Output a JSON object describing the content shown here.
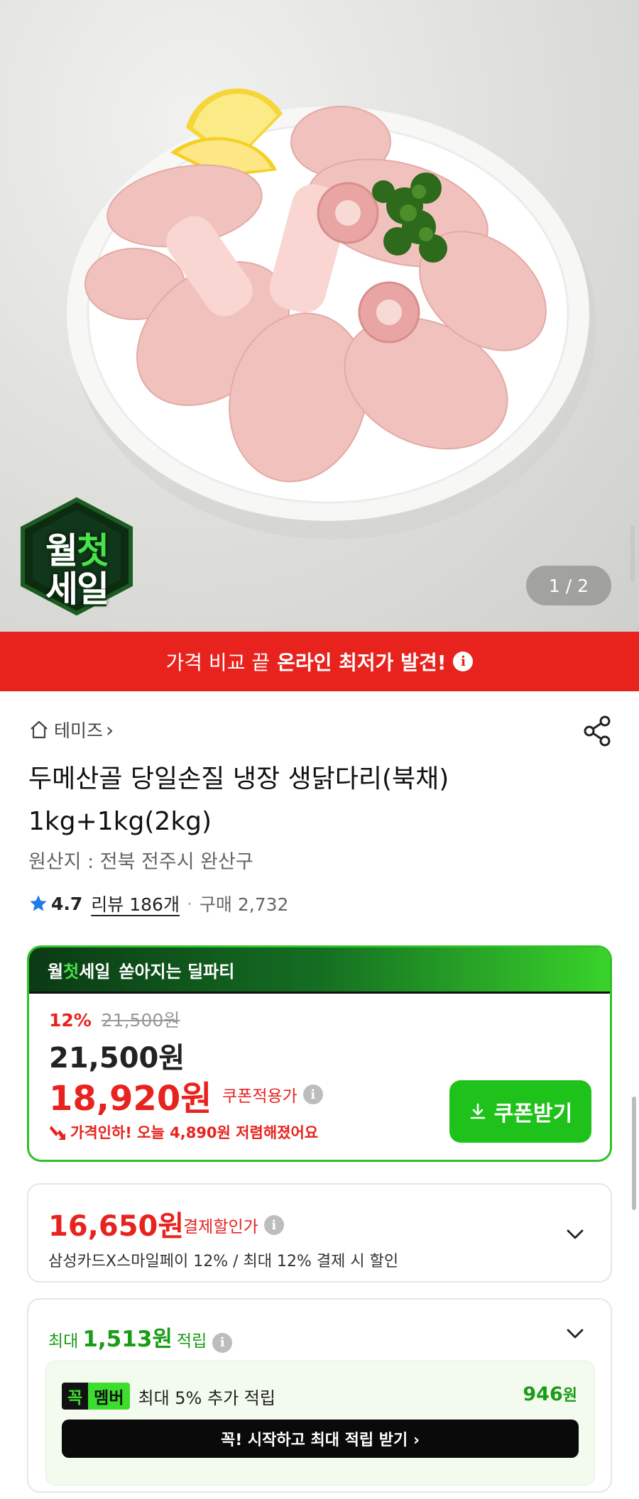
{
  "hero": {
    "badge_line1_a": "월",
    "badge_line1_b": "첫",
    "badge_line2": "세일",
    "counter": "1 / 2"
  },
  "banner": {
    "text": "가격 비교 끝",
    "strong": "온라인 최저가 발견!",
    "info": "i"
  },
  "shop": {
    "name": "테미즈",
    "chevron": "›"
  },
  "product": {
    "title": "두메산골 당일손질 냉장 생닭다리(북채) 1kg+1kg(2kg)",
    "origin": "원산지 : 전북 전주시 완산구",
    "rating": "4.7",
    "review_label": "리뷰 186개",
    "dot": "·",
    "purchase": "구매 2,732"
  },
  "deal": {
    "head_a": "월",
    "head_b": "첫",
    "head_c": "세일",
    "head_sub": "쏟아지는 딜파티",
    "discount_pct": "12%",
    "original_price": "21,500원",
    "price": "21,500원",
    "coupon_price": "18,920원",
    "coupon_label": "쿠폰적용가",
    "info": "i",
    "drop_note": "가격인하! 오늘 4,890원 저렴해졌어요",
    "coupon_button": "쿠폰받기"
  },
  "payment": {
    "price": "16,650원",
    "label": "결제할인가",
    "info": "i",
    "desc": "삼성카드X스마일페이 12% / 최대 12% 결제 시 할인"
  },
  "points": {
    "prefix": "최대",
    "amount": "1,513원",
    "suffix": "적립",
    "info": "i",
    "member_kkok": "꼭",
    "member_tag": "멤버",
    "member_text": "최대 5% 추가 적립",
    "member_amount": "946",
    "member_unit": "원",
    "member_button": "꼭! 시작하고 최대 적립 받기 ›"
  },
  "colors": {
    "accent_red": "#e8231e",
    "accent_green": "#1fc21a",
    "point_green": "#1a9c16"
  }
}
